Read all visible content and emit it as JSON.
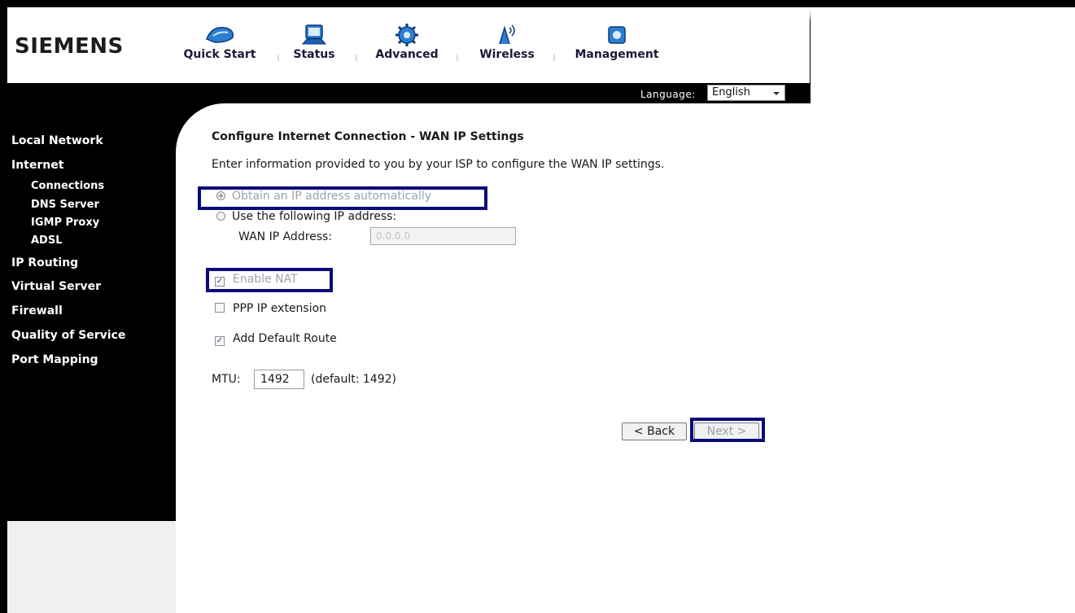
{
  "brand": "SIEMENS",
  "topnav": [
    {
      "label": "Quick Start",
      "icon": "quick-start-icon"
    },
    {
      "label": "Status",
      "icon": "status-icon"
    },
    {
      "label": "Advanced",
      "icon": "advanced-icon"
    },
    {
      "label": "Wireless",
      "icon": "wireless-icon"
    },
    {
      "label": "Management",
      "icon": "management-icon"
    }
  ],
  "language": {
    "label": "Language:",
    "value": "English"
  },
  "sidebar": {
    "items": [
      {
        "label": "Local Network"
      },
      {
        "label": "Internet"
      },
      {
        "label": "Connections"
      },
      {
        "label": "DNS Server"
      },
      {
        "label": "IGMP Proxy"
      },
      {
        "label": "ADSL"
      },
      {
        "label": "IP Routing"
      },
      {
        "label": "Virtual Server"
      },
      {
        "label": "Firewall"
      },
      {
        "label": "Quality of Service"
      },
      {
        "label": "Port Mapping"
      }
    ]
  },
  "main": {
    "title": "Configure Internet Connection - WAN IP Settings",
    "intro": "Enter information provided to you by your ISP to configure the WAN IP settings.",
    "radio_auto": "Obtain an IP address automatically",
    "radio_manual": "Use the following IP address:",
    "wan_ip_label": "WAN IP Address:",
    "wan_ip_value": "0.0.0.0",
    "enable_nat": "Enable NAT",
    "ppp_ip_extension": "PPP IP extension",
    "add_default_route": "Add Default Route",
    "mtu_label": "MTU:",
    "mtu_value": "1492",
    "mtu_default": "(default: 1492)",
    "back_label": "< Back",
    "next_label": "Next >"
  },
  "colors": {
    "highlight": "#0a0a7a",
    "sidebar_bg": "#000000",
    "disabled_text": "#9aa3ad"
  }
}
